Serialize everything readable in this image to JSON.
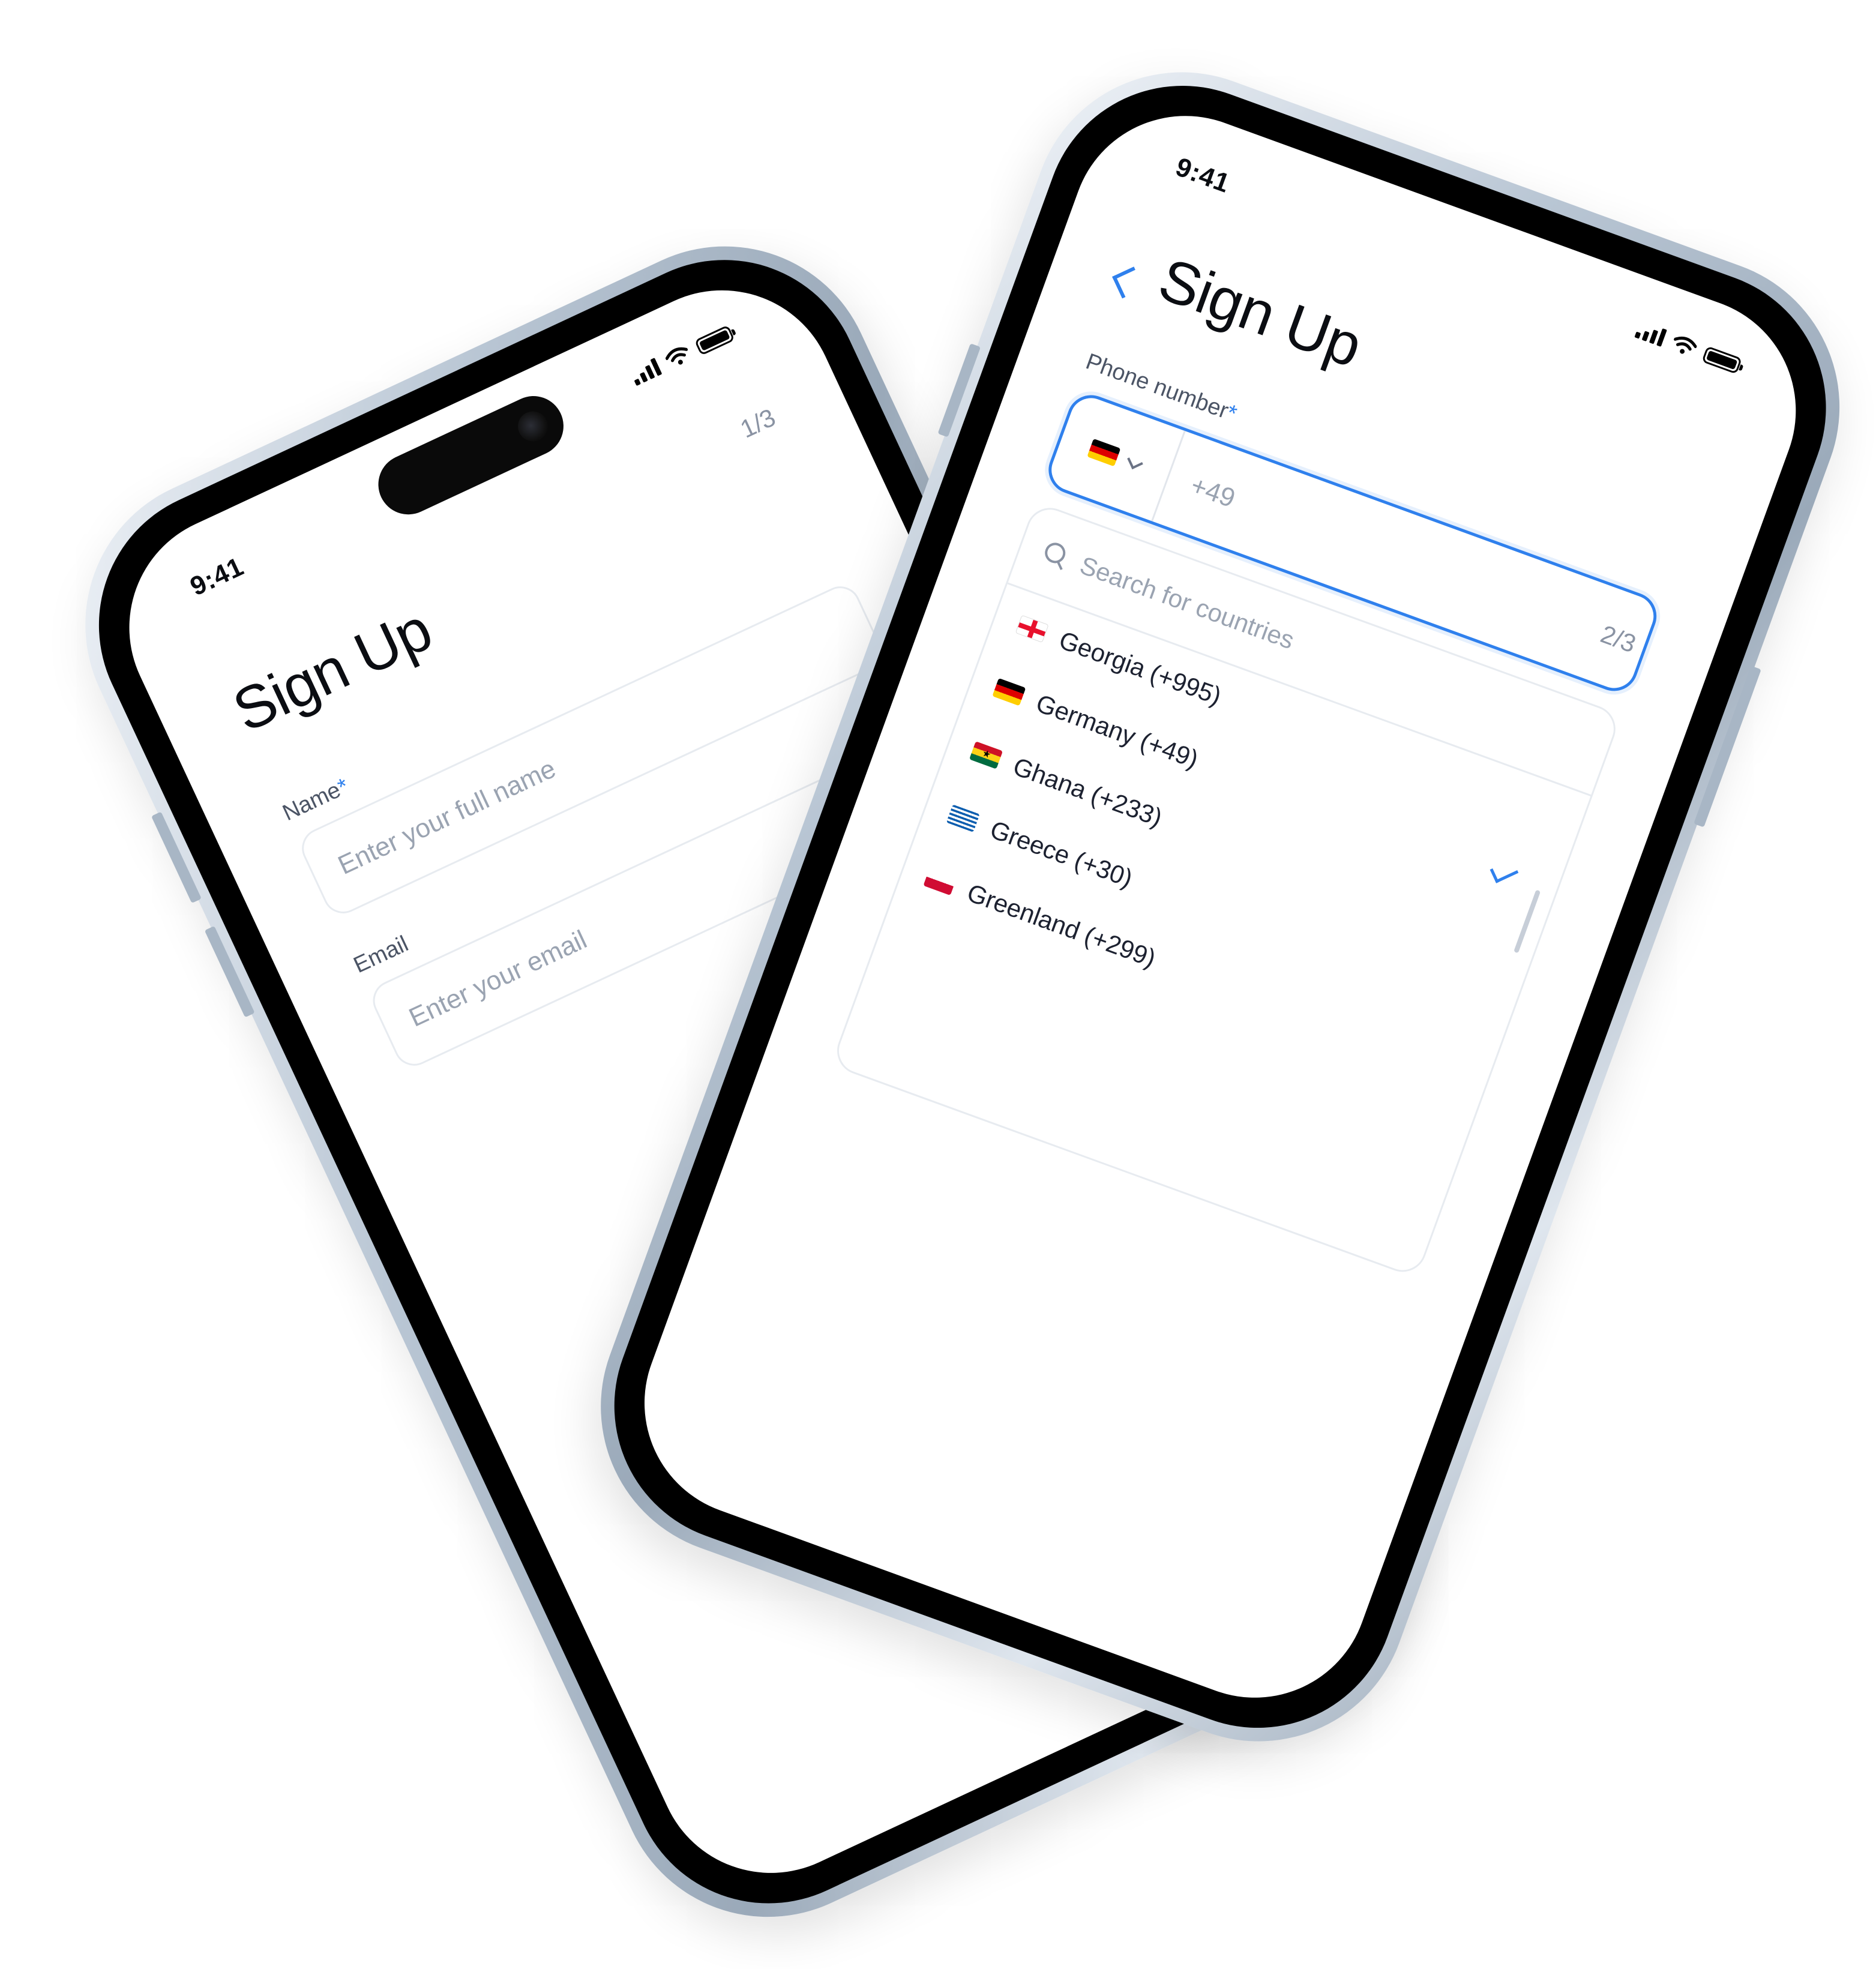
{
  "phone_left": {
    "status_time": "9:41",
    "step": "1/3",
    "title": "Sign Up",
    "name_label": "Name",
    "required_mark": "*",
    "name_placeholder": "Enter your full name",
    "email_label": "Email",
    "email_placeholder": "Enter your email"
  },
  "phone_right": {
    "status_time": "9:41",
    "step": "2/3",
    "title": "Sign Up",
    "phone_label": "Phone number",
    "required_mark": "*",
    "selected_country_flag": "flag-de",
    "dial_code_placeholder": "+49",
    "search_placeholder": "Search for countries",
    "countries": [
      {
        "label": "Georgia (+995)",
        "flag": "flag-ge",
        "selected": false
      },
      {
        "label": "Germany (+49)",
        "flag": "flag-de",
        "selected": true
      },
      {
        "label": "Ghana (+233)",
        "flag": "flag-gh",
        "selected": false
      },
      {
        "label": "Greece (+30)",
        "flag": "flag-gr",
        "selected": false
      },
      {
        "label": "Greenland (+299)",
        "flag": "flag-gl",
        "selected": false
      }
    ]
  },
  "colors": {
    "accent": "#2f80ed",
    "placeholder": "#9aa3b1",
    "border": "#e7ebf0"
  }
}
